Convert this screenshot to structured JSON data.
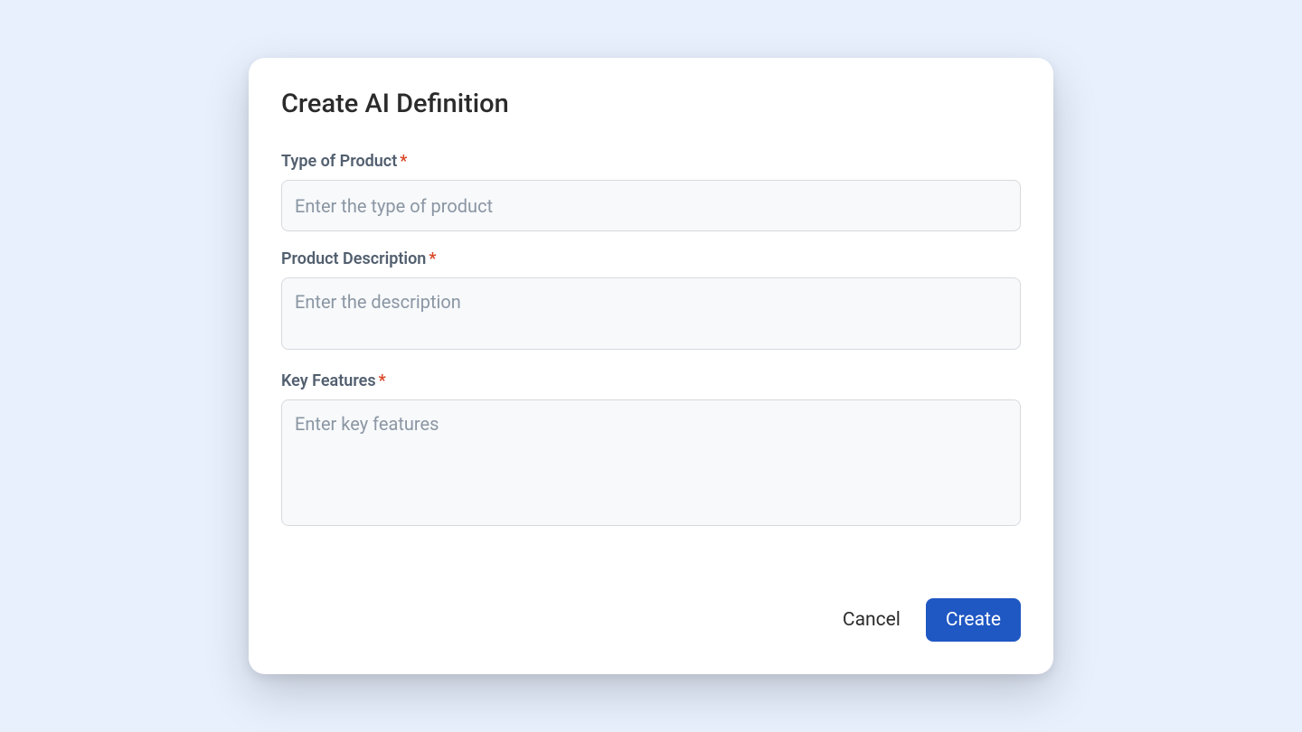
{
  "modal": {
    "title": "Create AI Definition",
    "fields": {
      "product_type": {
        "label": "Type of Product",
        "placeholder": "Enter the type of product",
        "required": true,
        "value": ""
      },
      "product_description": {
        "label": "Product Description",
        "placeholder": "Enter the description",
        "required": true,
        "value": ""
      },
      "key_features": {
        "label": "Key Features",
        "placeholder": "Enter key features",
        "required": true,
        "value": ""
      }
    },
    "actions": {
      "cancel_label": "Cancel",
      "create_label": "Create"
    }
  }
}
